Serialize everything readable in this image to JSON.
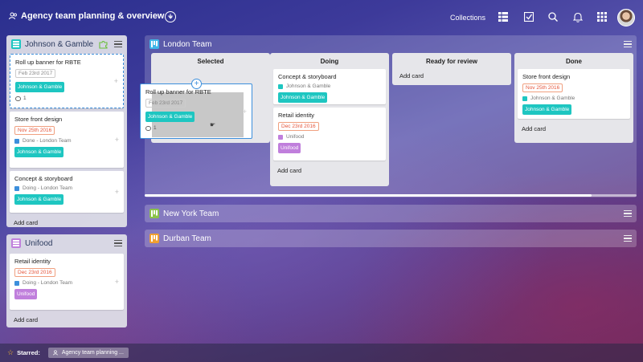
{
  "header": {
    "title": "Agency team planning & overview",
    "collections_label": "Collections",
    "icons": [
      "people-icon",
      "chevron-down-icon",
      "add-circle-icon",
      "grid-view-icon",
      "checklist-icon",
      "search-icon",
      "bell-icon",
      "apps-icon",
      "avatar"
    ]
  },
  "left_groups": [
    {
      "title": "Johnson & Gamble",
      "cards": [
        {
          "title": "Roll up banner for RBTE",
          "date": "Feb 23rd 2017",
          "tag": "Johnson & Gamble",
          "comments": "1"
        },
        {
          "title": "Store front design",
          "date": "Nov 25th 2016",
          "status": "Done - London Team",
          "tag": "Johnson & Gamble"
        },
        {
          "title": "Concept & storyboard",
          "status": "Doing - London Team",
          "tag": "Johnson & Gamble"
        }
      ],
      "add_card": "Add card"
    },
    {
      "title": "Unifood",
      "cards": [
        {
          "title": "Retail identity",
          "date": "Dec 23rd 2016",
          "status": "Doing - London Team",
          "tag": "Unifood"
        }
      ],
      "add_card": "Add card"
    }
  ],
  "board": {
    "title": "London Team",
    "lists": [
      {
        "title": "Selected"
      },
      {
        "title": "Doing",
        "cards": [
          {
            "title": "Concept & storyboard",
            "meta": "Johnson & Gamble",
            "tag": "Johnson & Gamble"
          },
          {
            "title": "Retail identity",
            "date": "Dec 23rd 2016",
            "meta": "Unifood",
            "tag": "Unifood"
          }
        ],
        "add_card": "Add card"
      },
      {
        "title": "Ready for review",
        "add_card": "Add card"
      },
      {
        "title": "Done",
        "cards": [
          {
            "title": "Store front design",
            "date": "Nov 25th 2016",
            "meta": "Johnson & Gamble",
            "tag": "Johnson & Gamble"
          }
        ],
        "add_card": "Add card"
      }
    ]
  },
  "drag_card": {
    "title": "Roll up banner for RBTE",
    "date": "Feb 23rd 2017",
    "tag": "Johnson & Gamble",
    "comments": "1"
  },
  "groups": [
    {
      "title": "New York Team"
    },
    {
      "title": "Durban Team"
    }
  ],
  "footer": {
    "starred_label": "Starred:",
    "starred_item": "Agency team planning ..."
  },
  "colors": {
    "teal": "#1ec6c1",
    "purple": "#c07fdc",
    "blue": "#3c8fdc",
    "green": "#8bc34a",
    "orange": "#f0a030"
  }
}
